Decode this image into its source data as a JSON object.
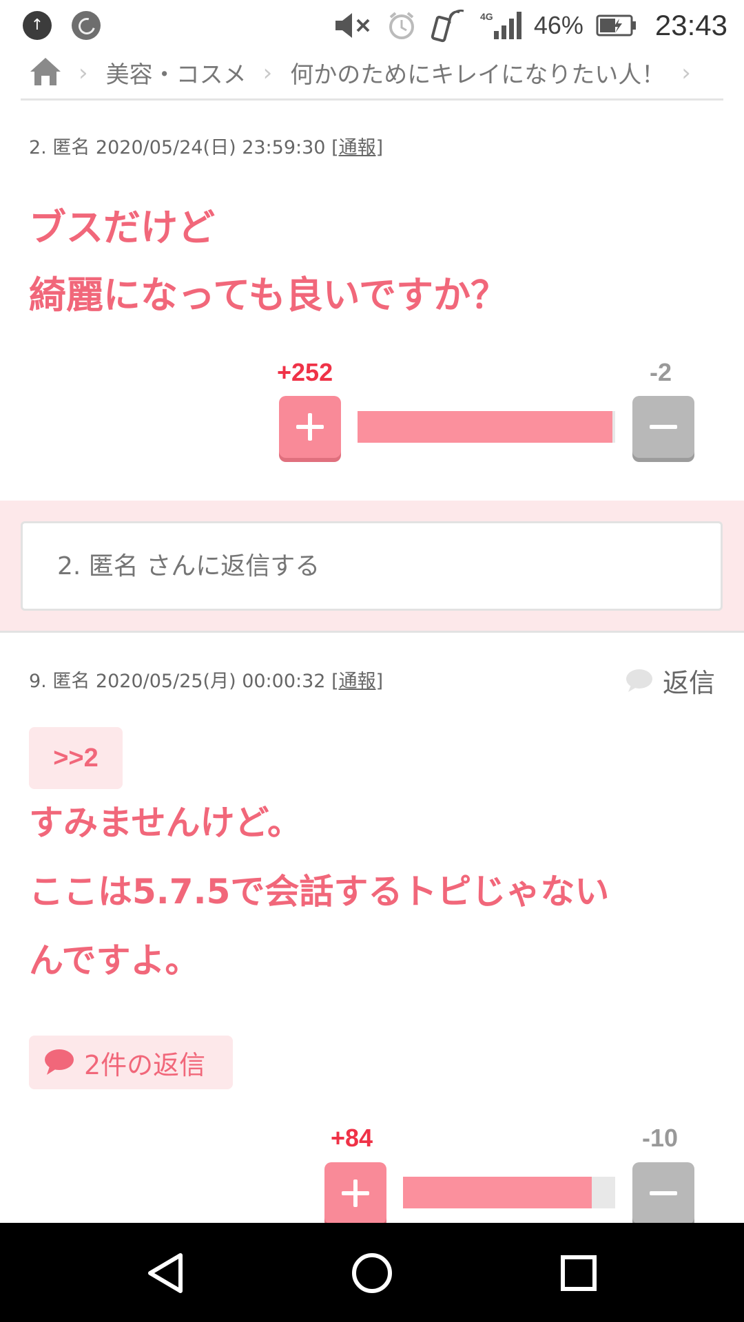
{
  "status_bar": {
    "battery_percent": "46%",
    "network": "4G",
    "time": "23:43"
  },
  "breadcrumb": {
    "items": [
      "美容・コスメ",
      "何かのためにキレイになりたい人！"
    ]
  },
  "comments": [
    {
      "meta": "2. 匿名 2020/05/24(日) 23:59:30",
      "report": "[通報]",
      "lines": [
        "ブスだけど",
        "綺麗になっても良いですか？"
      ],
      "plus": "+252",
      "minus": "-2",
      "plus_ratio": 0.99
    },
    {
      "meta": "9. 匿名 2020/05/25(月) 00:00:32",
      "report": "[通報]",
      "reply_label": "返信",
      "anchor": ">>2",
      "lines": [
        "すみませんけど。",
        "ここは5.7.5で会話するトピじゃない",
        "んですよ。"
      ],
      "replies_label": "2件の返信",
      "plus": "+84",
      "minus": "-10",
      "plus_ratio": 0.89
    }
  ],
  "reply_box": {
    "placeholder": "2. 匿名 さんに返信する"
  },
  "colors": {
    "accent": "#f1677a",
    "plus_button": "#f98a98",
    "minus_button": "#b8b8b8",
    "reply_bg": "#fde8ea"
  },
  "icons": [
    "upload-icon",
    "app-icon",
    "mute-icon",
    "alarm-icon",
    "wifi-calling-icon",
    "signal-icon",
    "battery-icon",
    "home-icon",
    "chevron-right-icon",
    "speech-bubble-icon",
    "back-icon",
    "home-circle-icon",
    "recents-icon"
  ]
}
